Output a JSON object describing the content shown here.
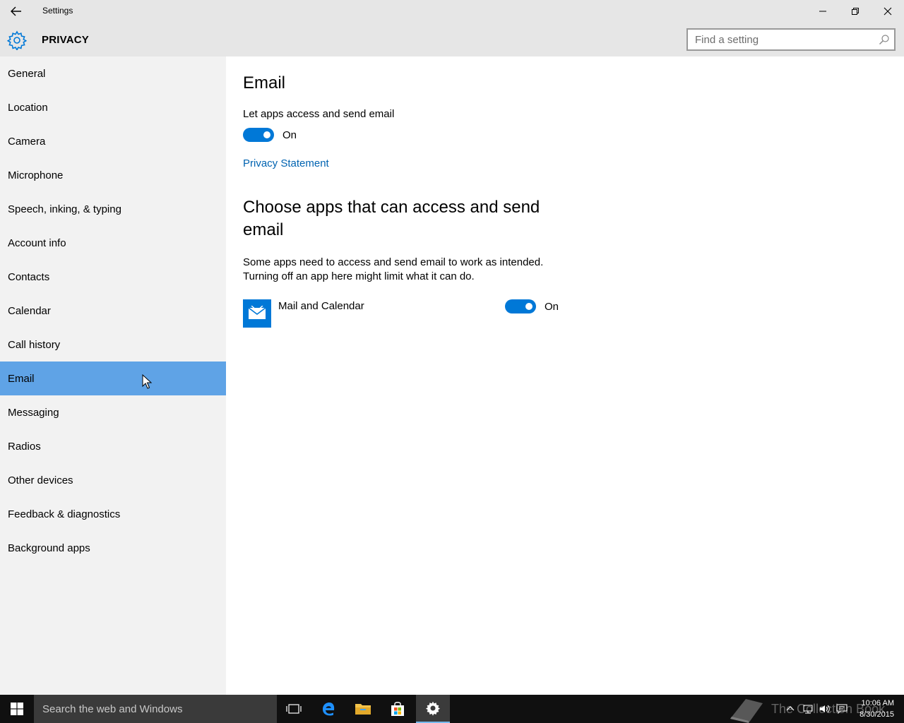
{
  "window": {
    "title": "Settings"
  },
  "header": {
    "title": "PRIVACY",
    "search_placeholder": "Find a setting"
  },
  "sidebar": {
    "items": [
      {
        "label": "General"
      },
      {
        "label": "Location"
      },
      {
        "label": "Camera"
      },
      {
        "label": "Microphone"
      },
      {
        "label": "Speech, inking, & typing"
      },
      {
        "label": "Account info"
      },
      {
        "label": "Contacts"
      },
      {
        "label": "Calendar"
      },
      {
        "label": "Call history"
      },
      {
        "label": "Email",
        "selected": true
      },
      {
        "label": "Messaging"
      },
      {
        "label": "Radios"
      },
      {
        "label": "Other devices"
      },
      {
        "label": "Feedback & diagnostics"
      },
      {
        "label": "Background apps"
      }
    ]
  },
  "main": {
    "heading": "Email",
    "master_label": "Let apps access and send email",
    "master_state": "On",
    "privacy_link": "Privacy Statement",
    "choose_heading": "Choose apps that can access and send email",
    "description_line1": "Some apps need to access and send email to work as intended.",
    "description_line2": "Turning off an app here might limit what it can do.",
    "apps": [
      {
        "name": "Mail and Calendar",
        "state": "On",
        "icon": "mail-icon"
      }
    ]
  },
  "taskbar": {
    "search_text": "Search the web and Windows",
    "watermark": "The Collection Book",
    "time": "10:06 AM",
    "date": "8/30/2015"
  },
  "colors": {
    "accent": "#0078d7",
    "selected_nav": "#5fa3e6",
    "link": "#0063b1",
    "chrome": "#e6e6e6",
    "sidebar": "#f2f2f2",
    "taskbar": "#101010"
  }
}
